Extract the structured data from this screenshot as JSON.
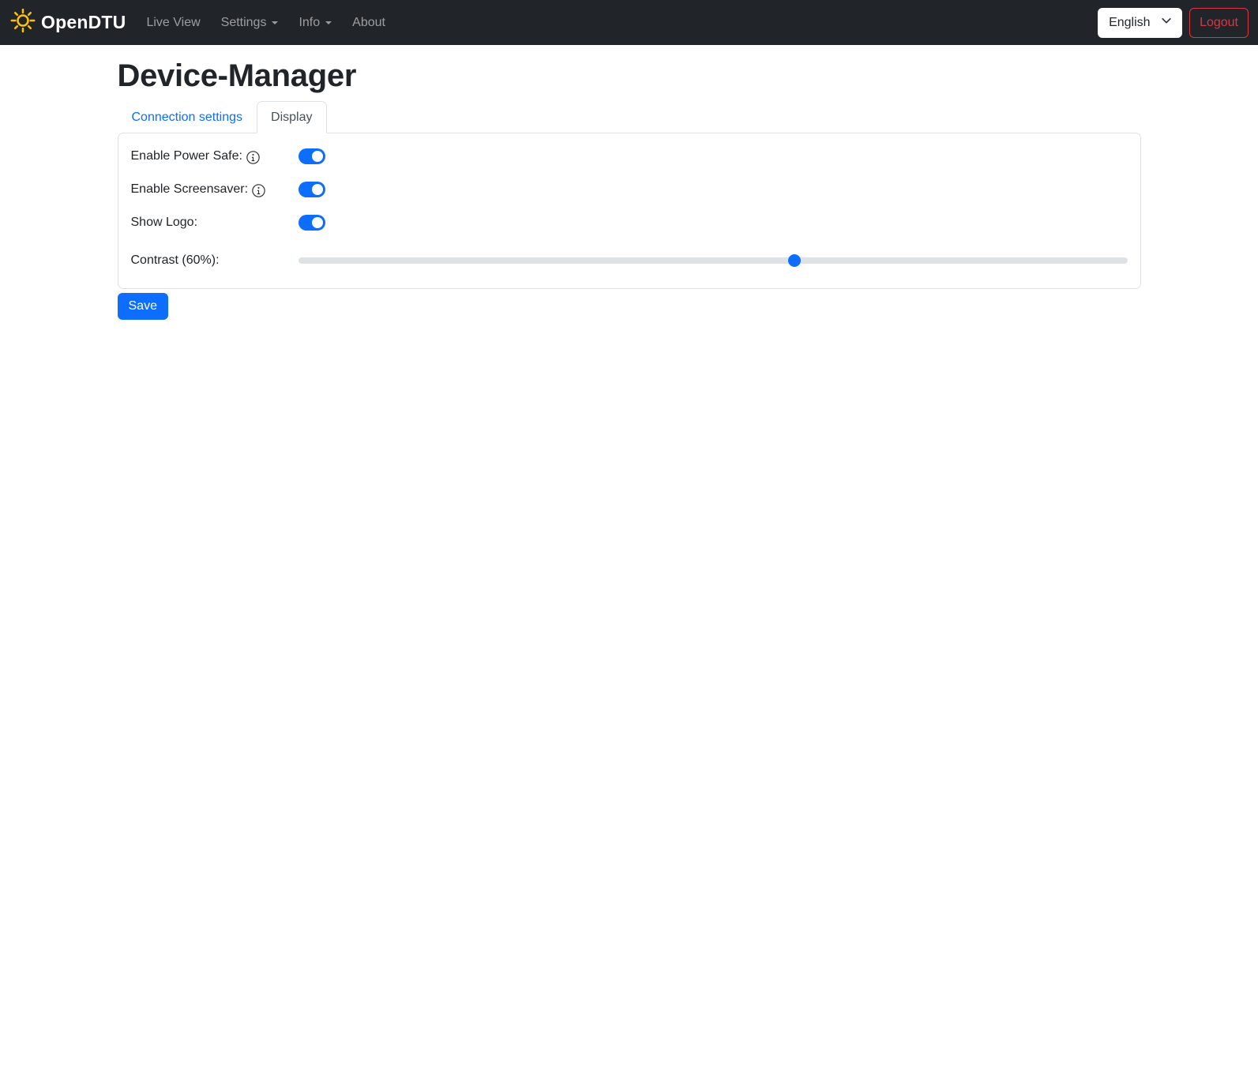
{
  "navbar": {
    "brand": "OpenDTU",
    "items": [
      {
        "label": "Live View",
        "has_caret": false
      },
      {
        "label": "Settings",
        "has_caret": true
      },
      {
        "label": "Info",
        "has_caret": true
      },
      {
        "label": "About",
        "has_caret": false
      }
    ],
    "language_select": {
      "value": "English"
    },
    "logout_label": "Logout"
  },
  "page": {
    "title": "Device-Manager"
  },
  "tabs": [
    {
      "label": "Connection settings",
      "active": false
    },
    {
      "label": "Display",
      "active": true
    }
  ],
  "form": {
    "rows": [
      {
        "label": "Enable Power Safe:",
        "has_info": true,
        "type": "switch",
        "value": true
      },
      {
        "label": "Enable Screensaver:",
        "has_info": true,
        "type": "switch",
        "value": true
      },
      {
        "label": "Show Logo:",
        "has_info": false,
        "type": "switch",
        "value": true
      },
      {
        "label": "Contrast (60%):",
        "has_info": false,
        "type": "range",
        "value": 60,
        "min": 0,
        "max": 100
      }
    ],
    "save_label": "Save"
  },
  "colors": {
    "navbar_bg": "#212529",
    "accent_blue": "#0d6efd",
    "danger_red": "#dc3545",
    "sun_yellow": "#ffc107",
    "border": "#dee2e6"
  }
}
